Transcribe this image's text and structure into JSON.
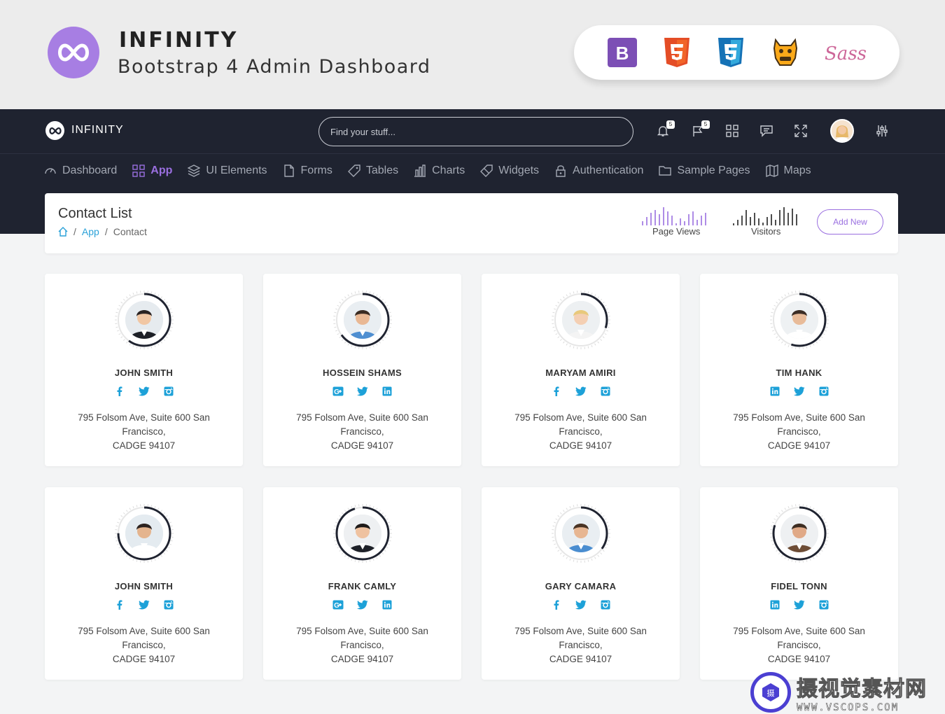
{
  "promo": {
    "title": "INFINITY",
    "subtitle": "Bootstrap 4 Admin Dashboard",
    "tech_icons": [
      "bootstrap-icon",
      "html5-icon",
      "css3-icon",
      "grunt-icon",
      "sass-icon"
    ],
    "bootstrap_letter": "B",
    "sass_text": "Sass"
  },
  "header": {
    "app_name": "INFINITY",
    "search_placeholder": "Find your stuff...",
    "notifications_count": "5",
    "flags_count": "5"
  },
  "nav": {
    "items": [
      {
        "label": "Dashboard",
        "icon": "gauge-icon"
      },
      {
        "label": "App",
        "icon": "grid-icon",
        "active": true
      },
      {
        "label": "UI Elements",
        "icon": "layers-icon"
      },
      {
        "label": "Forms",
        "icon": "file-icon"
      },
      {
        "label": "Tables",
        "icon": "tag-icon"
      },
      {
        "label": "Charts",
        "icon": "bar-chart-icon"
      },
      {
        "label": "Widgets",
        "icon": "widgets-icon"
      },
      {
        "label": "Authentication",
        "icon": "lock-icon"
      },
      {
        "label": "Sample Pages",
        "icon": "folder-icon"
      },
      {
        "label": "Maps",
        "icon": "map-icon"
      }
    ]
  },
  "page": {
    "title": "Contact List",
    "breadcrumb": [
      "App",
      "Contact"
    ],
    "stats": [
      {
        "label": "Page Views"
      },
      {
        "label": "Visitors"
      }
    ],
    "add_button": "Add New"
  },
  "contacts": [
    {
      "name": "JOHN SMITH",
      "socials": [
        "facebook-icon",
        "twitter-icon",
        "instagram-icon"
      ],
      "address_line1": "795 Folsom Ave, Suite 600 San",
      "address_line2": "Francisco,",
      "address_line3": "CADGE 94107",
      "progress": 0.6
    },
    {
      "name": "HOSSEIN SHAMS",
      "socials": [
        "google-plus-icon",
        "twitter-icon",
        "linkedin-icon"
      ],
      "address_line1": "795 Folsom Ave, Suite 600 San",
      "address_line2": "Francisco,",
      "address_line3": "CADGE 94107",
      "progress": 0.65
    },
    {
      "name": "MARYAM AMIRI",
      "socials": [
        "facebook-icon",
        "twitter-icon",
        "instagram-icon"
      ],
      "address_line1": "795 Folsom Ave, Suite 600 San",
      "address_line2": "Francisco,",
      "address_line3": "CADGE 94107",
      "progress": 0.3
    },
    {
      "name": "TIM HANK",
      "socials": [
        "linkedin-icon",
        "twitter-icon",
        "instagram-icon"
      ],
      "address_line1": "795 Folsom Ave, Suite 600 San",
      "address_line2": "Francisco,",
      "address_line3": "CADGE 94107",
      "progress": 0.55
    },
    {
      "name": "JOHN SMITH",
      "socials": [
        "facebook-icon",
        "twitter-icon",
        "instagram-icon"
      ],
      "address_line1": "795 Folsom Ave, Suite 600 San",
      "address_line2": "Francisco,",
      "address_line3": "CADGE 94107",
      "progress": 0.75
    },
    {
      "name": "FRANK CAMLY",
      "socials": [
        "google-plus-icon",
        "twitter-icon",
        "linkedin-icon"
      ],
      "address_line1": "795 Folsom Ave, Suite 600 San",
      "address_line2": "Francisco,",
      "address_line3": "CADGE 94107",
      "progress": 0.95
    },
    {
      "name": "GARY CAMARA",
      "socials": [
        "facebook-icon",
        "twitter-icon",
        "instagram-icon"
      ],
      "address_line1": "795 Folsom Ave, Suite 600 San",
      "address_line2": "Francisco,",
      "address_line3": "CADGE 94107",
      "progress": 0.35
    },
    {
      "name": "FIDEL TONN",
      "socials": [
        "linkedin-icon",
        "twitter-icon",
        "instagram-icon"
      ],
      "address_line1": "795 Folsom Ave, Suite 600 San",
      "address_line2": "Francisco,",
      "address_line3": "CADGE 94107",
      "progress": 0.8
    }
  ],
  "colors": {
    "accent": "#9a6fe0",
    "link": "#2aa1d8",
    "social": "#1da1d8",
    "dark": "#1f2330"
  },
  "watermark": {
    "cn": "摄视觉素材网",
    "en": "WWW.VSCOPS.COM"
  }
}
